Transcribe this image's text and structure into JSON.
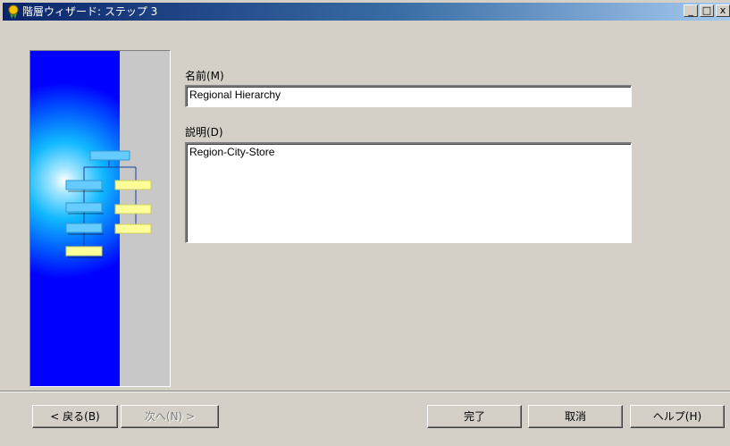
{
  "window": {
    "title": "階層ウィザード: ステップ 3",
    "controls": {
      "minimize": "_",
      "maximize": "□",
      "close": "x"
    }
  },
  "form": {
    "name_label": "名前(M)",
    "name_value": "Regional Hierarchy",
    "description_label": "説明(D)",
    "description_value": "Region-City-Store"
  },
  "buttons": {
    "back": "< 戻る(B)",
    "next": "次へ(N) >",
    "finish": "完了",
    "cancel": "取消",
    "help": "ヘルプ(H)"
  },
  "colors": {
    "titlebar_start": "#0a246a",
    "titlebar_end": "#a6caf0",
    "dialog_bg": "#d4d0c8",
    "wizard_blue": "#0000ff",
    "box_cyan": "#66ccff",
    "box_yellow": "#ffff99"
  },
  "icons": {
    "title_icon": "wizard-ribbon-icon",
    "illustration": "hierarchy-tree-illustration"
  }
}
